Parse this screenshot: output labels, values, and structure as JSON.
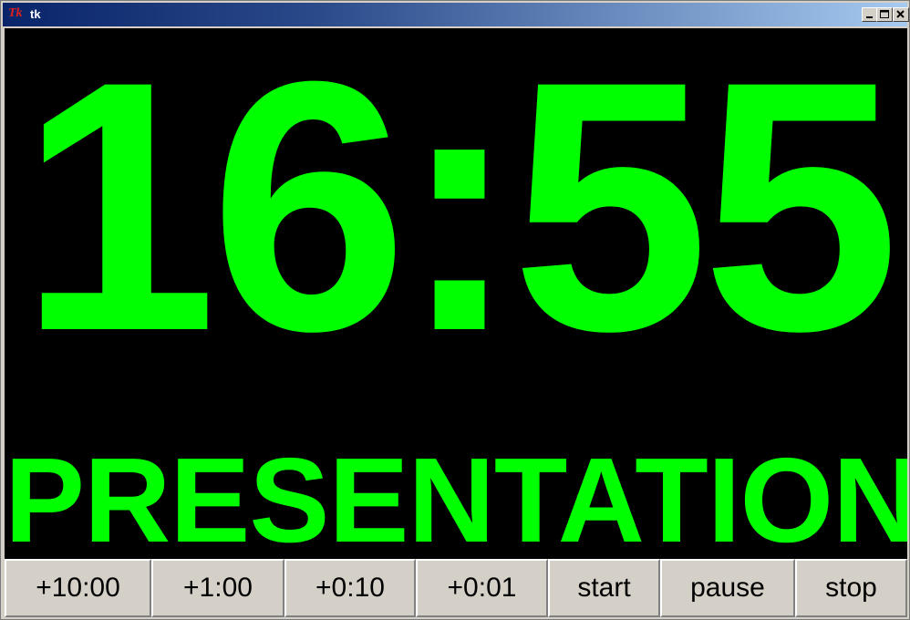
{
  "window": {
    "title": "tk",
    "app_logo": "Tk"
  },
  "colors": {
    "display_bg": "#000000",
    "text": "#00ff00",
    "button_bg": "#d4d0c8"
  },
  "timer": {
    "time": "16:55",
    "label": "PRESENTATION"
  },
  "buttons": [
    {
      "label": "+10:00"
    },
    {
      "label": "+1:00"
    },
    {
      "label": "+0:10"
    },
    {
      "label": "+0:01"
    },
    {
      "label": "start"
    },
    {
      "label": "pause"
    },
    {
      "label": "stop"
    }
  ],
  "icons": {
    "minimize": "minimize-icon",
    "maximize": "maximize-icon",
    "close": "close-icon"
  }
}
